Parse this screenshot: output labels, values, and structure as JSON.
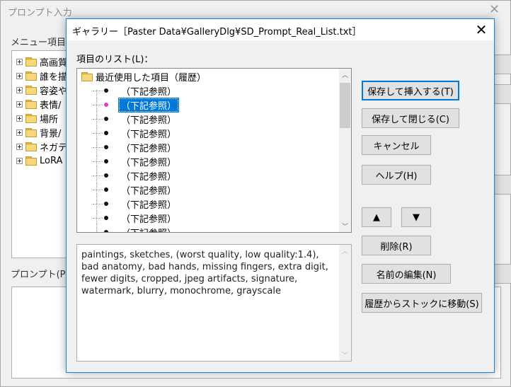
{
  "background_window": {
    "title": "プロンプト入力",
    "close_glyph": "✕",
    "menu_label": "メニュー項目(M",
    "tree_items": [
      "高画質",
      "誰を描",
      "容姿や",
      "表情/",
      "場所",
      "背景/",
      "ネガテ",
      "LoRA"
    ],
    "prompt_label": "プロンプト(P)："
  },
  "dialog": {
    "title": "ギャラリー［Paster Data¥GalleryDlg¥SD_Prompt_Real_List.txt］",
    "close_glyph": "✕",
    "list_label": "項目のリスト(L)：",
    "root_item": "最近使用した項目（履歴）",
    "items": [
      "（下記参照）",
      "（下記参照）",
      "（下記参照）",
      "（下記参照）",
      "（下記参照）",
      "（下記参照）",
      "（下記参照）",
      "（下記参照）",
      "（下記参照）",
      "（下記参照）",
      "（下記参照）"
    ],
    "selected_index": 1,
    "text_value": "paintings, sketches, (worst quality, low quality:1.4), bad anatomy, bad hands, missing fingers, extra digit, fewer digits, cropped, jpeg artifacts, signature, watermark, blurry, monochrome, grayscale",
    "buttons": {
      "save_insert": "保存して挿入する(T)",
      "save_close": "保存して閉じる(C)",
      "cancel": "キャンセル",
      "help": "ヘルプ(H)",
      "up": "▲",
      "down": "▼",
      "delete": "削除(R)",
      "rename": "名前の編集(N)",
      "move_to_stock": "履歴からストックに移動(S)"
    },
    "scroll_up_glyph": "︿",
    "scroll_down_glyph": "﹀"
  },
  "colors": {
    "accent": "#0078d7",
    "selected_bullet": "#e040c0"
  }
}
